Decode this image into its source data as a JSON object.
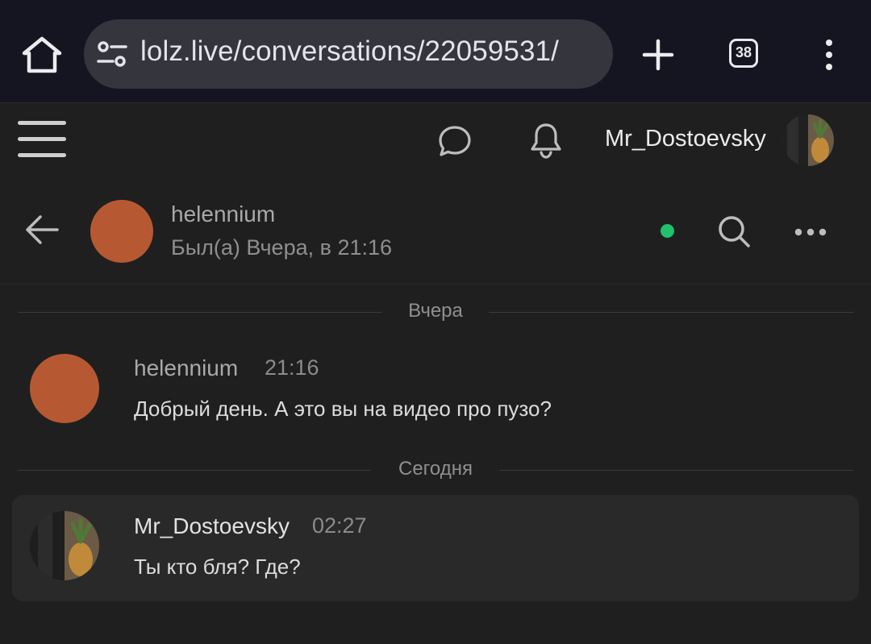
{
  "browser": {
    "url": "lolz.live/conversations/22059531/",
    "tab_count": "38",
    "icons": {
      "home": "home-icon",
      "site_info": "tune-icon",
      "new_tab": "plus-icon",
      "tabs": "tabs-icon",
      "menu": "more-vertical-icon"
    }
  },
  "site_header": {
    "username": "Mr_Dostoevsky",
    "icons": {
      "menu": "hamburger-icon",
      "conversations": "chat-bubble-icon",
      "alerts": "bell-icon"
    }
  },
  "conversation": {
    "partner_name": "helennium",
    "partner_status": "Был(а) Вчера, в 21:16",
    "online": true,
    "colors": {
      "avatar": "#b65932",
      "online_dot": "#22c16b"
    }
  },
  "messages": {
    "separator_yesterday": "Вчера",
    "separator_today": "Сегодня",
    "items": [
      {
        "author": "helennium",
        "time": "21:16",
        "text": "Добрый день. А это вы на видео про пузо?"
      },
      {
        "author": "Mr_Dostoevsky",
        "time": "02:27",
        "text": "Ты кто бля? Где?"
      }
    ]
  }
}
